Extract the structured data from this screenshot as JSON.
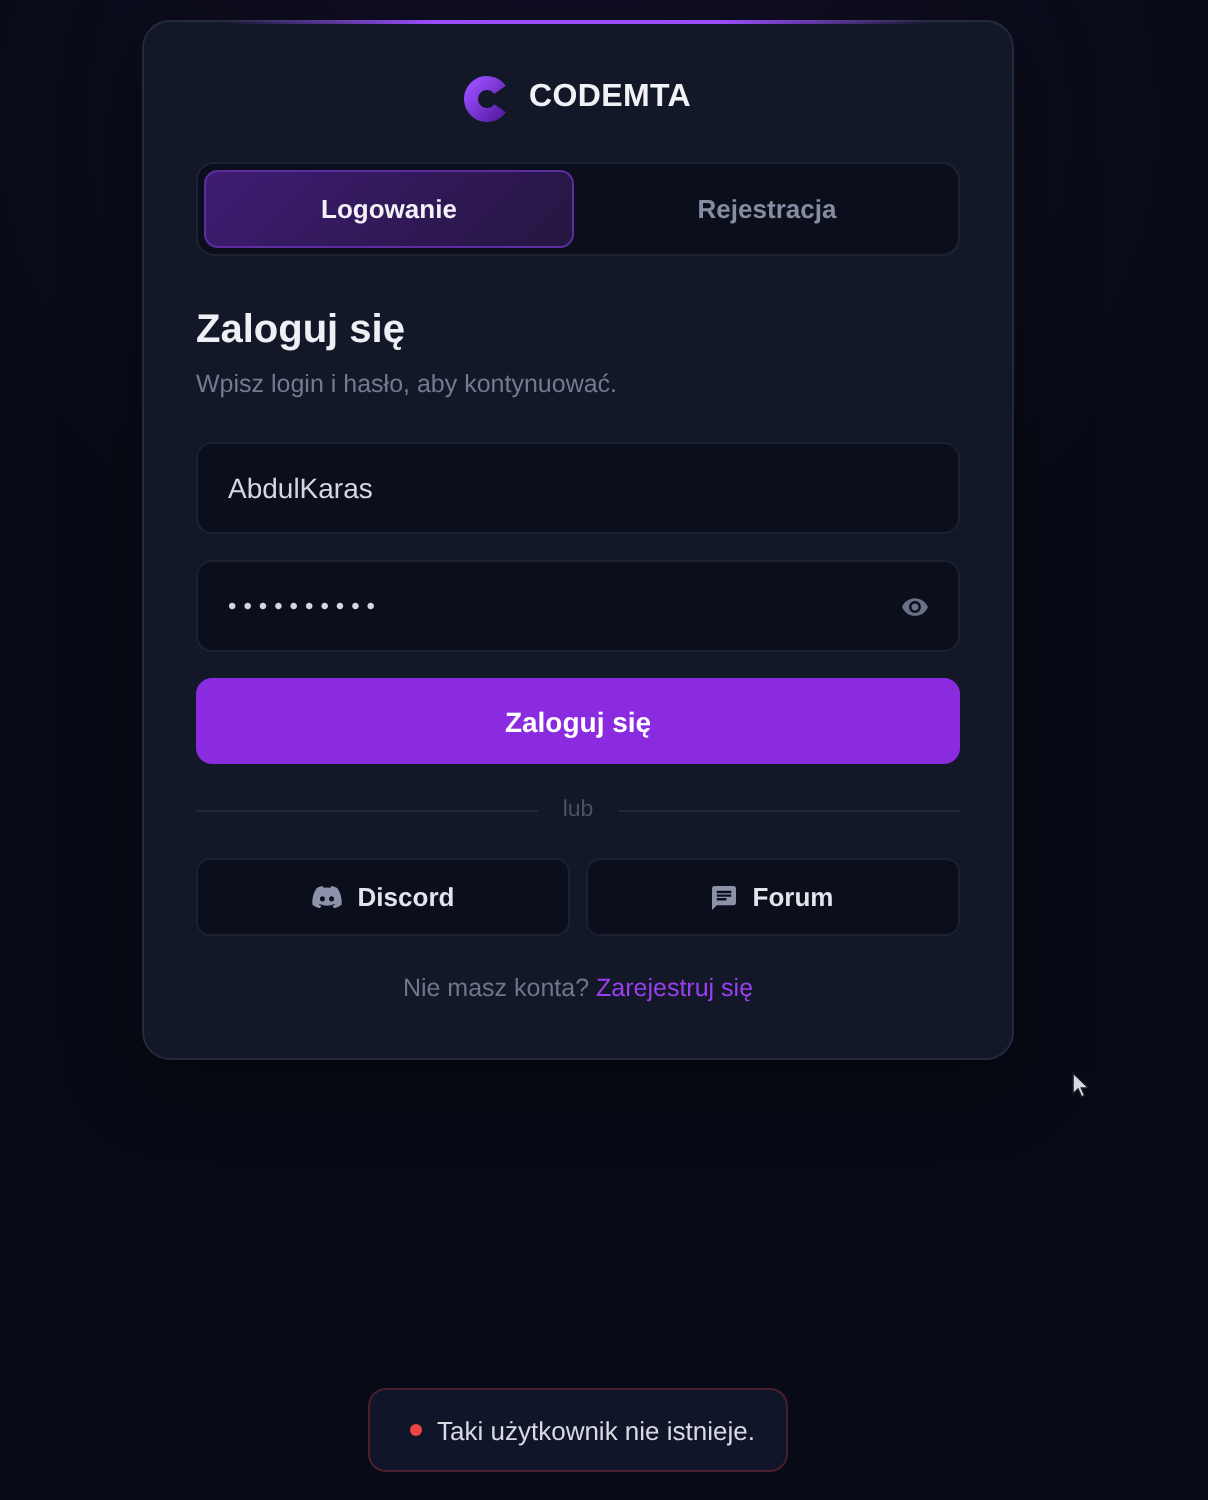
{
  "brand": {
    "name": "CODEMTA"
  },
  "tabs": [
    {
      "label": "Logowanie",
      "selected": true
    },
    {
      "label": "Rejestracja",
      "selected": false
    }
  ],
  "heading": "Zaloguj się",
  "subtitle": "Wpisz login i hasło, aby kontynuować.",
  "fields": [
    {
      "kind": "text",
      "value": "AbdulKaras"
    },
    {
      "kind": "password",
      "value": "••••••••••"
    }
  ],
  "submit": {
    "label": "Zaloguj się"
  },
  "divider": "lub",
  "social": [
    {
      "kind": "discord",
      "label": "Discord"
    },
    {
      "kind": "forum",
      "label": "Forum"
    }
  ],
  "footer": {
    "text": "Nie masz konta?",
    "link": "Zarejestruj się"
  },
  "toast": {
    "kind": "error",
    "text": "Taki użytkownik nie istnieje."
  }
}
